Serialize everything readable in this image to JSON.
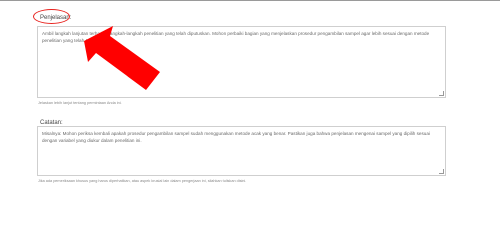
{
  "explanation": {
    "label": "Penjelasan:",
    "text": "Ambil langkah lanjutan terhadap langkah-langkah penelitian yang telah diputuskan. Mohon perbaiki bagian yang menjelaskan prosedur pengambilan sampel agar lebih sesuai dengan metode penelitian yang telah Anda tetapkan.",
    "help": "Jelaskan lebih lanjut tentang permintaan Anda ini."
  },
  "notes": {
    "label": "Catatan:",
    "text": "Misalnya: Mohon periksa kembali apakah prosedur pengambilan sampel sudah menggunakan metode acak yang benar. Pastikan juga bahwa penjelasan mengenai sampel yang dipilih sesuai dengan variabel yang diukur dalam penelitian ini.",
    "help": "Jika ada pemeriksaan khusus yang harus diperhatikan, atau aspek krusial lain dalam pengerjaan ini, silahkan tuliskan disini."
  },
  "annotation": {
    "highlight_color": "#e8231f",
    "arrow_icon": "red-arrow-icon"
  }
}
